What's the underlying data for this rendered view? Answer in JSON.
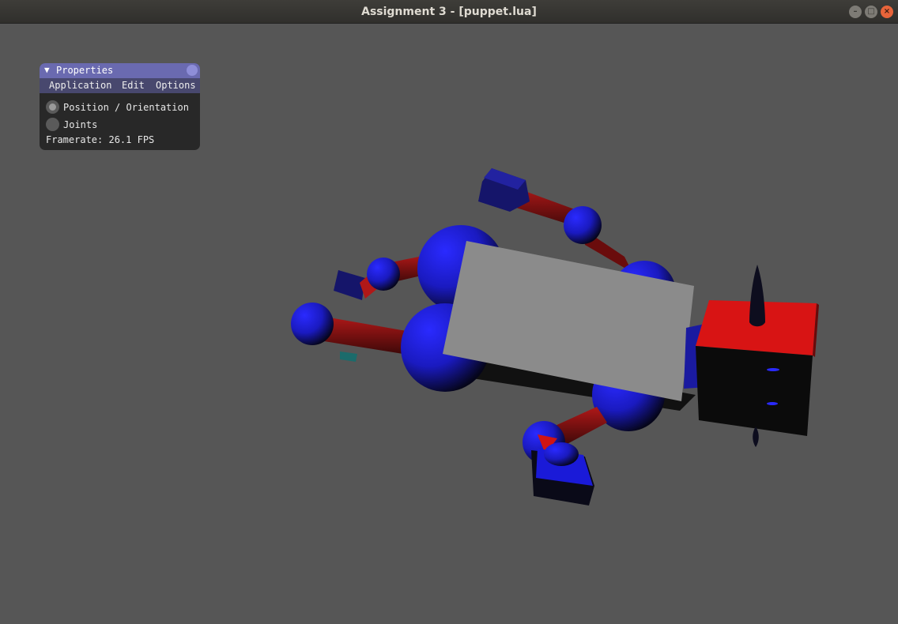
{
  "window": {
    "title": "Assignment 3 - [puppet.lua]",
    "minimize_glyph": "–",
    "maximize_glyph": "□",
    "close_glyph": "×"
  },
  "properties_panel": {
    "collapse_glyph": "▼",
    "title": "Properties",
    "menu": [
      "Application",
      "Edit",
      "Options"
    ],
    "modes": [
      {
        "label": "Position / Orientation",
        "selected": true
      },
      {
        "label": "Joints",
        "selected": false
      }
    ],
    "framerate_text": "Framerate: 26.1 FPS"
  },
  "colors": {
    "background": "#565656",
    "puppet_blue": "#1a1ad0",
    "puppet_red": "#d01414",
    "torso_gray": "#8a8a8a",
    "panel_header": "#6a6ab0"
  }
}
